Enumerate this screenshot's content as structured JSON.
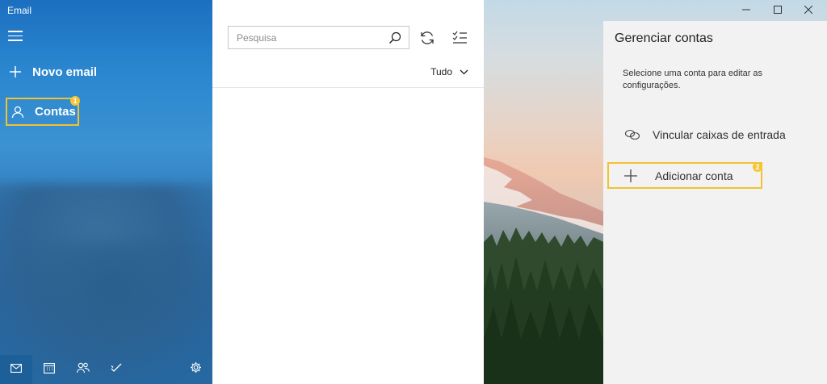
{
  "app": {
    "title": "Email"
  },
  "nav": {
    "new_mail_label": "Novo email",
    "accounts_label": "Contas",
    "accounts_step": "1"
  },
  "bottom_bar": {
    "items": [
      "mail-icon",
      "calendar-icon",
      "people-icon",
      "todo-icon",
      "settings-icon"
    ]
  },
  "message_list": {
    "search_placeholder": "Pesquisa",
    "filter_label": "Tudo"
  },
  "flyout": {
    "title": "Gerenciar contas",
    "description": "Selecione uma conta para editar as configurações.",
    "link_inboxes_label": "Vincular caixas de entrada",
    "add_account_label": "Adicionar conta",
    "add_account_step": "2"
  },
  "colors": {
    "highlight": "#f2c230",
    "badge": "#f4c534",
    "nav_blue": "#2a86cf",
    "flyout_bg": "#f2f2f2"
  }
}
